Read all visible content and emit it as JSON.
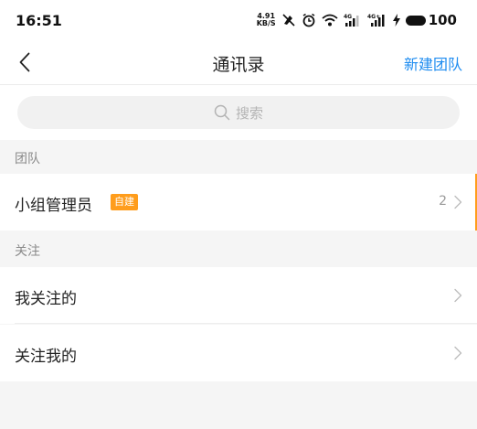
{
  "status_bar": {
    "time": "16:51",
    "net_speed_value": "4.91",
    "net_speed_unit": "KB/S",
    "signal_1_tech": "4G",
    "signal_2_tech": "4G+",
    "battery": "100"
  },
  "nav": {
    "title": "通讯录",
    "action": "新建团队"
  },
  "search": {
    "placeholder": "搜索"
  },
  "sections": {
    "team": {
      "header": "团队",
      "rows": [
        {
          "label": "小组管理员",
          "badge": "自建",
          "count": "2"
        }
      ]
    },
    "follow": {
      "header": "关注",
      "rows": [
        {
          "label": "我关注的"
        },
        {
          "label": "关注我的"
        }
      ]
    }
  },
  "colors": {
    "accent_blue": "#1e8cf0",
    "badge_orange": "#ff9d1c",
    "background": "#f5f5f5"
  }
}
